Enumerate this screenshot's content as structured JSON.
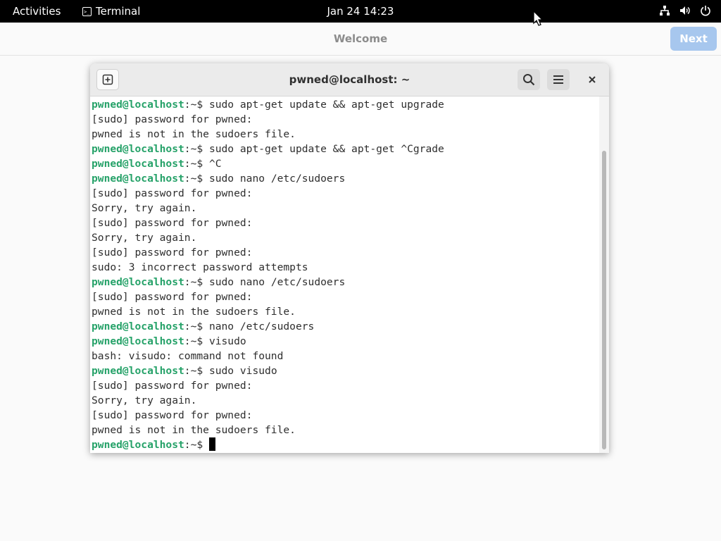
{
  "topbar": {
    "activities": "Activities",
    "app_name": "Terminal",
    "app_icon_glyph": ">_",
    "clock": "Jan 24  14:23",
    "tray_icons": [
      "network-icon",
      "volume-icon",
      "power-icon"
    ]
  },
  "welcome": {
    "title": "Welcome",
    "next_label": "Next"
  },
  "terminal": {
    "title": "pwned@localhost: ~",
    "prompt_user": "pwned@localhost",
    "prompt_path": ":~$ ",
    "lines": [
      {
        "type": "cmd",
        "text": "sudo apt-get update && apt-get upgrade"
      },
      {
        "type": "out",
        "text": "[sudo] password for pwned:"
      },
      {
        "type": "out",
        "text": "pwned is not in the sudoers file."
      },
      {
        "type": "cmd",
        "text": "sudo apt-get update && apt-get ^Cgrade"
      },
      {
        "type": "cmd",
        "text": "^C"
      },
      {
        "type": "cmd",
        "text": "sudo nano /etc/sudoers"
      },
      {
        "type": "out",
        "text": "[sudo] password for pwned:"
      },
      {
        "type": "out",
        "text": "Sorry, try again."
      },
      {
        "type": "out",
        "text": "[sudo] password for pwned:"
      },
      {
        "type": "out",
        "text": "Sorry, try again."
      },
      {
        "type": "out",
        "text": "[sudo] password for pwned:"
      },
      {
        "type": "out",
        "text": "sudo: 3 incorrect password attempts"
      },
      {
        "type": "cmd",
        "text": "sudo nano /etc/sudoers"
      },
      {
        "type": "out",
        "text": "[sudo] password for pwned:"
      },
      {
        "type": "out",
        "text": "pwned is not in the sudoers file."
      },
      {
        "type": "cmd",
        "text": "nano /etc/sudoers"
      },
      {
        "type": "cmd",
        "text": "visudo"
      },
      {
        "type": "out",
        "text": "bash: visudo: command not found"
      },
      {
        "type": "cmd",
        "text": "sudo visudo"
      },
      {
        "type": "out",
        "text": "[sudo] password for pwned:"
      },
      {
        "type": "out",
        "text": "Sorry, try again."
      },
      {
        "type": "out",
        "text": "[sudo] password for pwned:"
      },
      {
        "type": "out",
        "text": "pwned is not in the sudoers file."
      },
      {
        "type": "prompt",
        "text": ""
      }
    ],
    "colors": {
      "prompt_user": "#26a269",
      "text": "#2e2e2e",
      "background": "#ffffff"
    }
  }
}
